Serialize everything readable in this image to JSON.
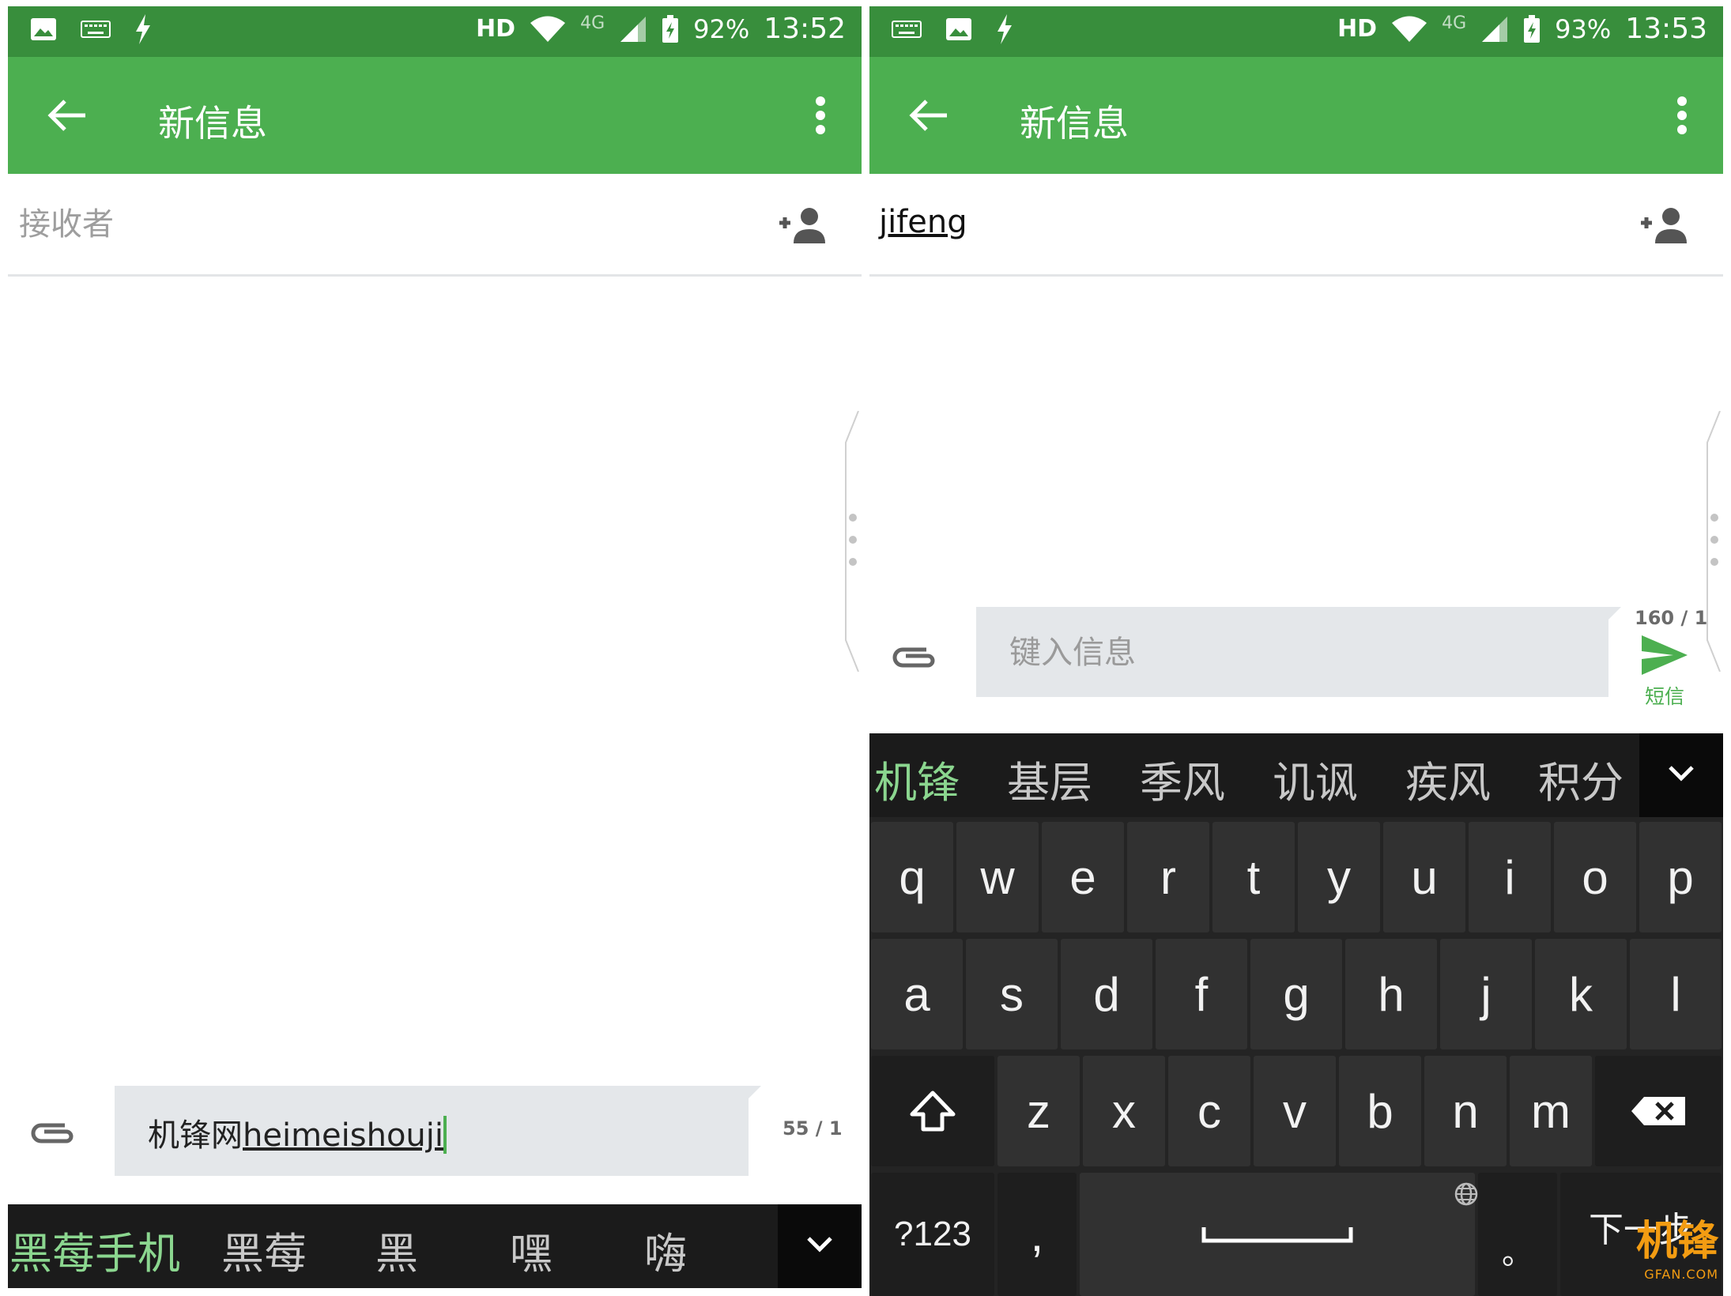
{
  "left": {
    "status": {
      "hd": "HD",
      "net": "4G",
      "battery": "92%",
      "time": "13:52"
    },
    "appbar": {
      "title": "新信息"
    },
    "recipient": {
      "placeholder": "接收者"
    },
    "compose": {
      "hanzi": "机锋网",
      "pinyin": "heimeishouji",
      "counter": "55 / 1"
    },
    "candidates": [
      "黑莓手机",
      "黑莓",
      "黑",
      "嘿",
      "嗨"
    ]
  },
  "right": {
    "status": {
      "hd": "HD",
      "net": "4G",
      "battery": "93%",
      "time": "13:53"
    },
    "appbar": {
      "title": "新信息"
    },
    "recipient": {
      "chip": "jifeng"
    },
    "compose": {
      "placeholder": "键入信息",
      "counter": "160 / 1",
      "send_label": "短信"
    },
    "candidates": [
      "机锋",
      "基层",
      "季风",
      "讥讽",
      "疾风",
      "积分"
    ],
    "keyboard": {
      "row1": [
        "q",
        "w",
        "e",
        "r",
        "t",
        "y",
        "u",
        "i",
        "o",
        "p"
      ],
      "row2": [
        "a",
        "s",
        "d",
        "f",
        "g",
        "h",
        "j",
        "k",
        "l"
      ],
      "row3": [
        "z",
        "x",
        "c",
        "v",
        "b",
        "n",
        "m"
      ],
      "symbols": "?123",
      "comma": ",",
      "period": "。",
      "next": "下一步"
    }
  },
  "watermark": {
    "logo": "机锋",
    "sub": "GFAN.COM"
  },
  "colors": {
    "status": "#388e3c",
    "appbar": "#4caf50",
    "keyboard": "#242424",
    "candidate_active": "#8bd68f"
  },
  "icons": [
    "image-icon",
    "keyboard-icon",
    "flash-icon",
    "wifi-icon",
    "signal-icon",
    "battery-icon",
    "back-arrow-icon",
    "overflow-menu-icon",
    "add-contact-icon",
    "paperclip-icon",
    "send-icon",
    "chevron-down-icon",
    "shift-icon",
    "backspace-icon",
    "globe-icon"
  ]
}
